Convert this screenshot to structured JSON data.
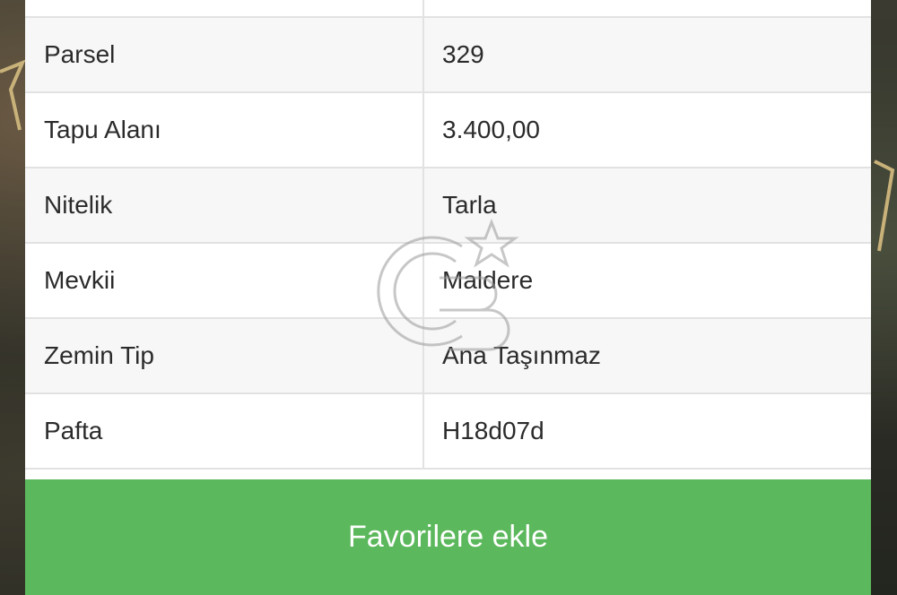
{
  "details": {
    "rows": [
      {
        "label": "Parsel",
        "value": "329"
      },
      {
        "label": "Tapu Alanı",
        "value": "3.400,00"
      },
      {
        "label": "Nitelik",
        "value": "Tarla"
      },
      {
        "label": "Mevkii",
        "value": "Maldere"
      },
      {
        "label": "Zemin Tip",
        "value": "Ana Taşınmaz"
      },
      {
        "label": "Pafta",
        "value": "H18d07d"
      }
    ]
  },
  "actions": {
    "favorite_label": "Favorilere ekle"
  },
  "colors": {
    "button_green": "#5cb85c",
    "row_alt": "#f7f7f7",
    "border": "#e2e2e2",
    "parcel_outline": "#c9b27a"
  },
  "icons": {
    "watermark": "brand-logo-watermark"
  }
}
